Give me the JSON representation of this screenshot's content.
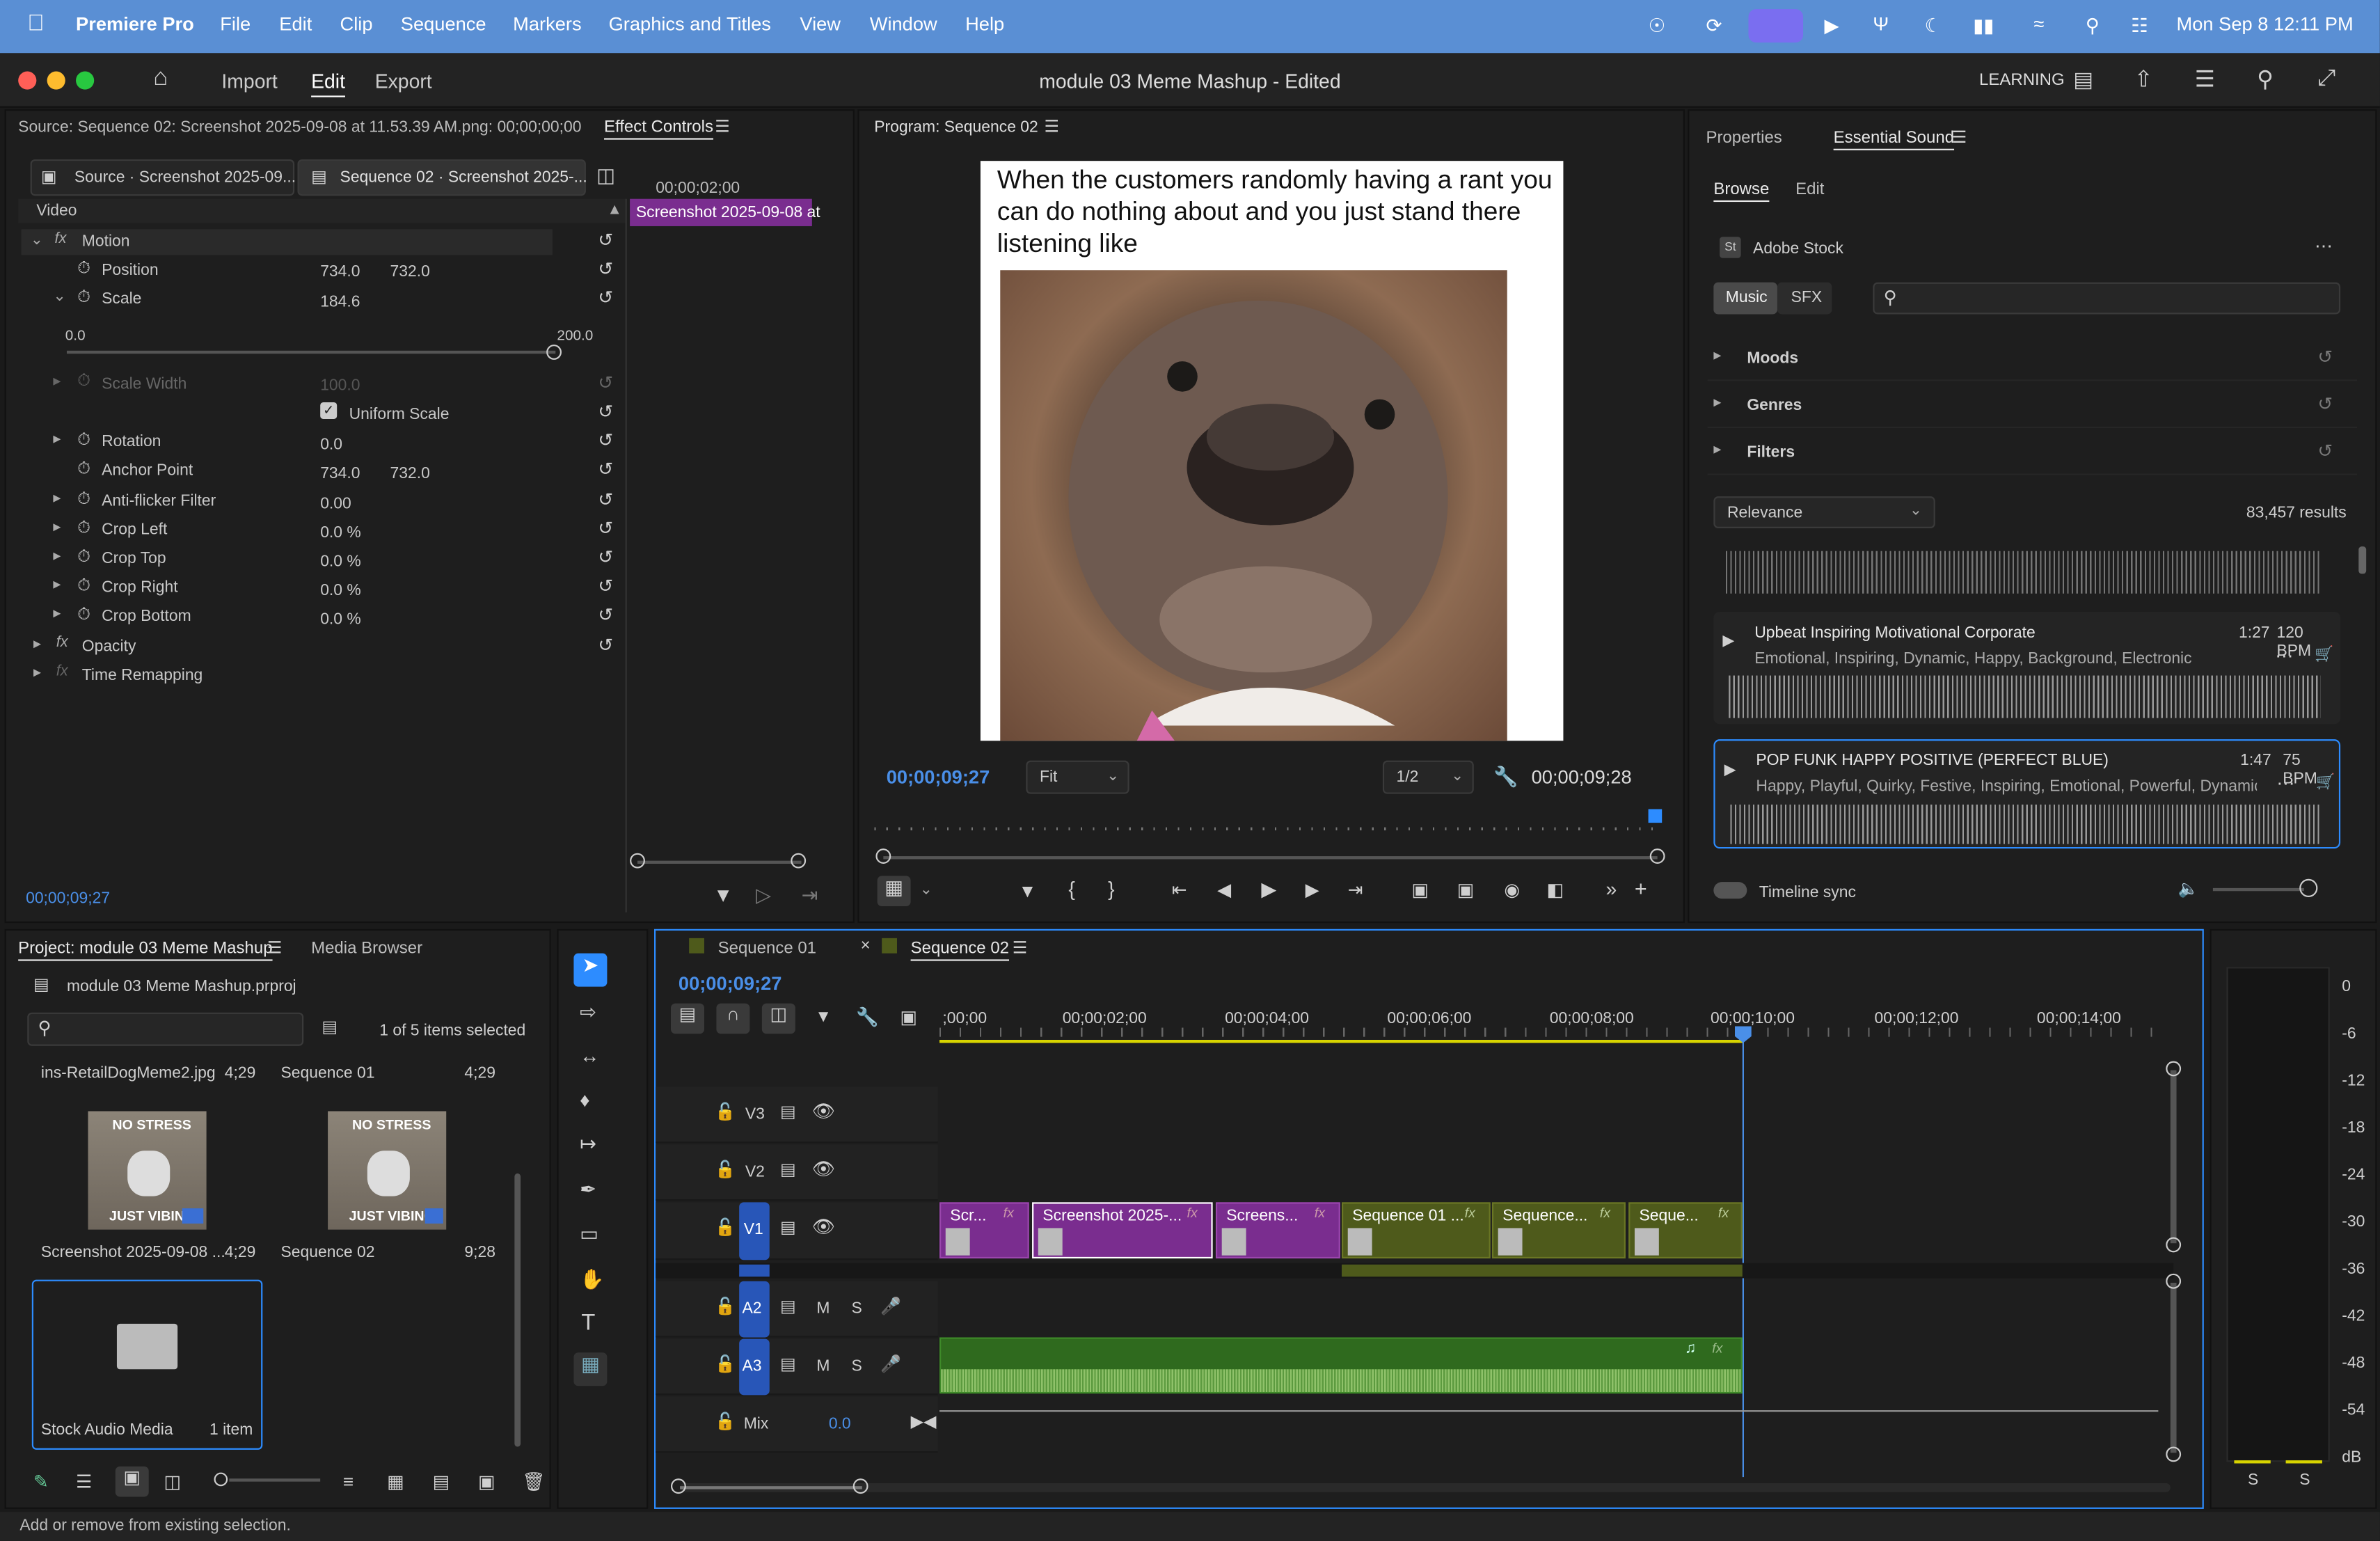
{
  "menubar": {
    "app_name": "Premiere Pro",
    "items": [
      "File",
      "Edit",
      "Clip",
      "Sequence",
      "Markers",
      "Graphics and Titles",
      "View",
      "Window",
      "Help"
    ],
    "datetime": "Mon Sep 8  12:11 PM"
  },
  "header": {
    "nav": [
      "Import",
      "Edit",
      "Export"
    ],
    "title": "module 03 Meme Mashup - Edited",
    "workspace": "LEARNING"
  },
  "effect_controls": {
    "source_label": "Source: Sequence 02: Screenshot 2025-09-08 at 11.53.39 AM.png: 00;00;00;00",
    "tab": "Effect Controls",
    "subtab_source": "Source · Screenshot 2025-09...",
    "subtab_seq": "Sequence 02 · Screenshot 2025-...",
    "timecode_ruler": "00;00;02;00",
    "clip_label": "Screenshot 2025-09-08 at",
    "video_header": "Video",
    "rows": {
      "motion": "Motion",
      "position": "Position",
      "position_x": "734.0",
      "position_y": "732.0",
      "scale": "Scale",
      "scale_val": "184.6",
      "slider_min": "0.0",
      "slider_max": "200.0",
      "scale_width": "Scale Width",
      "scale_width_val": "100.0",
      "uniform_scale": "Uniform Scale",
      "rotation": "Rotation",
      "rotation_val": "0.0",
      "anchor": "Anchor Point",
      "anchor_x": "734.0",
      "anchor_y": "732.0",
      "antiflicker": "Anti-flicker Filter",
      "antiflicker_val": "0.00",
      "crop_left": "Crop Left",
      "crop_left_val": "0.0 %",
      "crop_top": "Crop Top",
      "crop_top_val": "0.0 %",
      "crop_right": "Crop Right",
      "crop_right_val": "0.0 %",
      "crop_bottom": "Crop Bottom",
      "crop_bottom_val": "0.0 %",
      "opacity": "Opacity",
      "time_remap": "Time Remapping"
    },
    "bottom_timecode": "00;00;09;27"
  },
  "program": {
    "title": "Program: Sequence 02",
    "meme_caption": "When the customers randomly having a rant you can do nothing about and you just stand there listening like",
    "timecode": "00;00;09;27",
    "fit": "Fit",
    "resolution": "1/2",
    "duration": "00;00;09;28"
  },
  "essential_sound": {
    "tabs": [
      "Properties",
      "Essential Sound"
    ],
    "subtabs": [
      "Browse",
      "Edit"
    ],
    "adobe_stock": "Adobe Stock",
    "toggle": [
      "Music",
      "SFX"
    ],
    "sections": [
      "Moods",
      "Genres",
      "Filters"
    ],
    "sort": "Relevance",
    "results": "83,457 results",
    "tracks": [
      {
        "title": "Upbeat Inspiring Motivational Corporate",
        "duration": "1:27",
        "bpm": "120 BPM",
        "tags": "Emotional, Inspiring, Dynamic, Happy, Background, Electronic"
      },
      {
        "title": "POP FUNK HAPPY POSITIVE (PERFECT BLUE)",
        "duration": "1:47",
        "bpm": "75 BPM",
        "tags": "Happy, Playful, Quirky, Festive, Inspiring, Emotional, Powerful, Dynamic, ..."
      }
    ],
    "timeline_sync": "Timeline sync"
  },
  "project": {
    "tabs": [
      "Project: module 03 Meme Mashup",
      "Media Browser"
    ],
    "file": "module 03 Meme Mashup.prproj",
    "selection": "1 of 5 items selected",
    "list_top": [
      {
        "name": "ins-RetailDogMeme2.jpg",
        "dur": "4;29"
      },
      {
        "name": "Sequence 01",
        "dur": "4;29"
      }
    ],
    "thumbs": [
      {
        "name": "Screenshot 2025-09-08 ...",
        "dur": "4;29",
        "caption_top": "NO STRESS",
        "caption_bot": "JUST VIBING"
      },
      {
        "name": "Sequence 02",
        "dur": "9;28",
        "caption_top": "NO STRESS",
        "caption_bot": "JUST VIBING"
      }
    ],
    "folder": {
      "name": "Stock Audio Media",
      "count": "1 item"
    }
  },
  "timeline": {
    "tabs": [
      "Sequence 01",
      "Sequence 02"
    ],
    "timecode": "00;00;09;27",
    "ruler": [
      ";00;00",
      "00;00;02;00",
      "00;00;04;00",
      "00;00;06;00",
      "00;00;08;00",
      "00;00;10;00",
      "00;00;12;00",
      "00;00;14;00"
    ],
    "tracks": {
      "v3": "V3",
      "v2": "V2",
      "v1": "V1",
      "a2": "A2",
      "a3": "A3",
      "mix": "Mix",
      "mix_val": "0.0",
      "m": "M",
      "s": "S"
    },
    "clips": [
      "Scr...",
      "Screenshot 2025-...",
      "Screens...",
      "Sequence 01 ...",
      "Sequence...",
      "Seque..."
    ]
  },
  "meter": {
    "scale": [
      "0",
      "-6",
      "-12",
      "-18",
      "-24",
      "-30",
      "-36",
      "-42",
      "-48",
      "-54",
      "dB"
    ],
    "channels": [
      "S",
      "S"
    ]
  },
  "status": "Add or remove from existing selection.",
  "colors": {
    "accent": "#2d8cff",
    "purple_clip": "#7a2d8f",
    "olive_clip": "#4e5a1b",
    "audio_clip": "#2f6a1e",
    "menubar": "#5a8fd4"
  }
}
